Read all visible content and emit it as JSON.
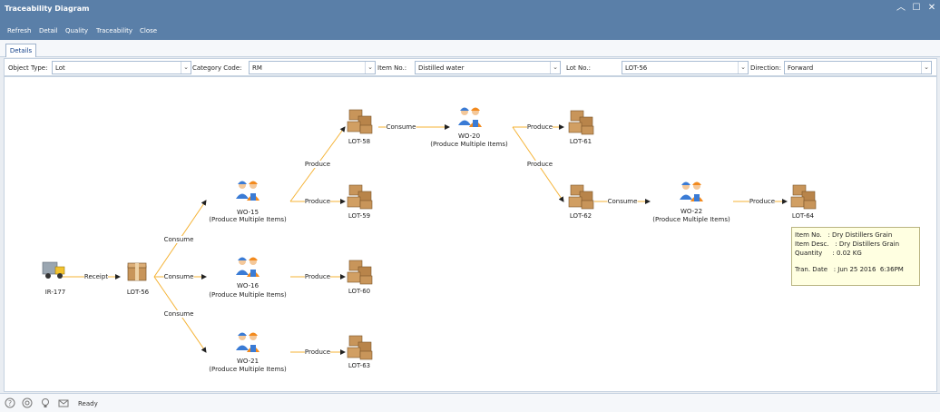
{
  "window": {
    "title": "Traceability Diagram",
    "minimize_glyph": "︿",
    "maximize_glyph": "☐",
    "close_glyph": "✕"
  },
  "toolbar": {
    "refresh": "Refresh",
    "detail": "Detail",
    "quality": "Quality",
    "traceability": "Traceability",
    "close": "Close"
  },
  "tabs": {
    "details": "Details"
  },
  "filters": {
    "object_type": {
      "label": "Object Type:",
      "value": "Lot"
    },
    "category_code": {
      "label": "Category Code:",
      "value": "RM"
    },
    "item_no": {
      "label": "Item No.:",
      "value": "Distilled water"
    },
    "lot_no": {
      "label": "Lot No.:",
      "value": "LOT-56"
    },
    "direction": {
      "label": "Direction:",
      "value": "Forward"
    }
  },
  "nodes": {
    "ir177": {
      "label": "IR-177",
      "icon": "truck-icon"
    },
    "lot56": {
      "label": "LOT-56",
      "icon": "box-icon"
    },
    "wo15": {
      "label": "WO-15",
      "sub": "(Produce Multiple Items)",
      "icon": "workers-icon"
    },
    "wo16": {
      "label": "WO-16",
      "sub": "(Produce Multiple Items)",
      "icon": "workers-icon"
    },
    "wo21": {
      "label": "WO-21",
      "sub": "(Produce Multiple Items)",
      "icon": "workers-icon"
    },
    "lot58": {
      "label": "LOT-58",
      "icon": "boxes-icon"
    },
    "lot59": {
      "label": "LOT-59",
      "icon": "boxes-icon"
    },
    "lot60": {
      "label": "LOT-60",
      "icon": "boxes-icon"
    },
    "lot63": {
      "label": "LOT-63",
      "icon": "boxes-icon"
    },
    "wo20": {
      "label": "WO-20",
      "sub": "(Produce Multiple Items)",
      "icon": "workers-icon"
    },
    "lot61": {
      "label": "LOT-61",
      "icon": "boxes-icon"
    },
    "lot62": {
      "label": "LOT-62",
      "icon": "boxes-icon"
    },
    "wo22": {
      "label": "WO-22",
      "sub": "(Produce Multiple Items)",
      "icon": "workers-icon"
    },
    "lot64": {
      "label": "LOT-64",
      "icon": "boxes-icon"
    }
  },
  "edges": {
    "receipt": "Receipt",
    "consume": "Consume",
    "produce": "Produce"
  },
  "tooltip": {
    "item_no": "Item No.   : Dry Distillers Grain",
    "item_desc": "Item Desc.   : Dry Distillers Grain",
    "quantity": "Quantity     : 0.02 KG",
    "tran_date": "Tran. Date   : Jun 25 2016  6:36PM"
  },
  "status": {
    "text": "Ready",
    "icons": [
      "help-icon",
      "support-icon",
      "lightbulb-icon",
      "mail-icon"
    ]
  },
  "colors": {
    "header": "#5a7fa8",
    "edge": "#f5b335",
    "tooltip_bg": "#ffffe1"
  }
}
